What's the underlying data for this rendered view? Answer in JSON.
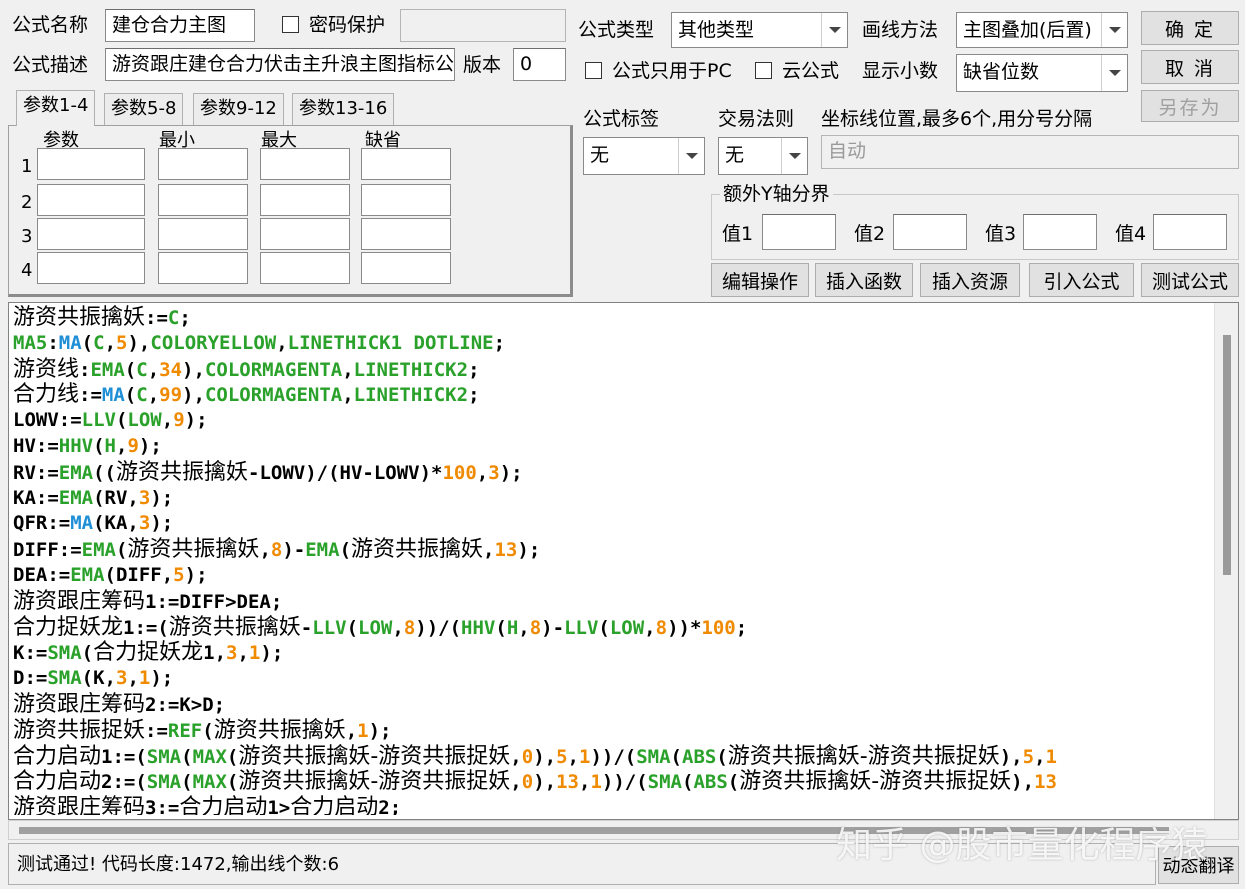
{
  "form": {
    "name_label": "公式名称",
    "name_value": "建仓合力主图",
    "password_label": "密码保护",
    "desc_label": "公式描述",
    "desc_value": "游资跟庄建仓合力伏击主升浪主图指标公",
    "version_label": "版本",
    "version_value": "0",
    "type_label": "公式类型",
    "type_value": "其他类型",
    "draw_label": "画线方法",
    "draw_value": "主图叠加(后置)",
    "pc_only_label": "公式只用于PC",
    "cloud_label": "云公式",
    "decimal_label": "显示小数",
    "decimal_value": "缺省位数",
    "tag_label": "公式标签",
    "tag_value": "无",
    "rule_label": "交易法则",
    "rule_value": "无",
    "coord_label": "坐标线位置,最多6个,用分号分隔",
    "coord_placeholder": "自动",
    "yaxis_group": "额外Y轴分界",
    "yaxis_labels": [
      "值1",
      "值2",
      "值3",
      "值4"
    ]
  },
  "buttons": {
    "ok": "确 定",
    "cancel": "取 消",
    "save_as": "另存为",
    "edit_ops": "编辑操作",
    "insert_func": "插入函数",
    "insert_res": "插入资源",
    "import": "引入公式",
    "test": "测试公式",
    "dyn_translate": "动态翻译"
  },
  "tabs": [
    "参数1-4",
    "参数5-8",
    "参数9-12",
    "参数13-16"
  ],
  "params": {
    "headers": [
      "参数",
      "最小",
      "最大",
      "缺省"
    ],
    "rows": [
      "1",
      "2",
      "3",
      "4"
    ]
  },
  "code_lines": [
    [
      [
        "cjk",
        "游资共振擒妖"
      ],
      [
        "d",
        ":="
      ],
      [
        "f",
        "C"
      ],
      [
        "d",
        ";"
      ]
    ],
    [
      [
        "f",
        "MA5"
      ],
      [
        "d",
        ":"
      ],
      [
        "m",
        "MA"
      ],
      [
        "d",
        "("
      ],
      [
        "f",
        "C"
      ],
      [
        "d",
        ","
      ],
      [
        "n",
        "5"
      ],
      [
        "d",
        "),"
      ],
      [
        "f",
        "COLORYELLOW"
      ],
      [
        "d",
        ","
      ],
      [
        "f",
        "LINETHICK1 DOTLINE"
      ],
      [
        "d",
        ";"
      ]
    ],
    [
      [
        "cjk",
        "游资线"
      ],
      [
        "d",
        ":"
      ],
      [
        "f",
        "EMA"
      ],
      [
        "d",
        "("
      ],
      [
        "f",
        "C"
      ],
      [
        "d",
        ","
      ],
      [
        "n",
        "34"
      ],
      [
        "d",
        "),"
      ],
      [
        "f",
        "COLORMAGENTA"
      ],
      [
        "d",
        ","
      ],
      [
        "f",
        "LINETHICK2"
      ],
      [
        "d",
        ";"
      ]
    ],
    [
      [
        "cjk",
        "合力线"
      ],
      [
        "d",
        ":="
      ],
      [
        "m",
        "MA"
      ],
      [
        "d",
        "("
      ],
      [
        "f",
        "C"
      ],
      [
        "d",
        ","
      ],
      [
        "n",
        "99"
      ],
      [
        "d",
        "),"
      ],
      [
        "f",
        "COLORMAGENTA"
      ],
      [
        "d",
        ","
      ],
      [
        "f",
        "LINETHICK2"
      ],
      [
        "d",
        ";"
      ]
    ],
    [
      [
        "d",
        "LOWV:="
      ],
      [
        "f",
        "LLV"
      ],
      [
        "d",
        "("
      ],
      [
        "f",
        "LOW"
      ],
      [
        "d",
        ","
      ],
      [
        "n",
        "9"
      ],
      [
        "d",
        ");"
      ]
    ],
    [
      [
        "d",
        "HV:="
      ],
      [
        "f",
        "HHV"
      ],
      [
        "d",
        "("
      ],
      [
        "f",
        "H"
      ],
      [
        "d",
        ","
      ],
      [
        "n",
        "9"
      ],
      [
        "d",
        ");"
      ]
    ],
    [
      [
        "d",
        "RV:="
      ],
      [
        "f",
        "EMA"
      ],
      [
        "d",
        "(("
      ],
      [
        "cjk",
        "游资共振擒妖"
      ],
      [
        "d",
        "-LOWV)/(HV-LOWV)*"
      ],
      [
        "n",
        "100"
      ],
      [
        "d",
        ","
      ],
      [
        "n",
        "3"
      ],
      [
        "d",
        ");"
      ]
    ],
    [
      [
        "d",
        "KA:="
      ],
      [
        "f",
        "EMA"
      ],
      [
        "d",
        "(RV,"
      ],
      [
        "n",
        "3"
      ],
      [
        "d",
        ");"
      ]
    ],
    [
      [
        "d",
        "QFR:="
      ],
      [
        "m",
        "MA"
      ],
      [
        "d",
        "(KA,"
      ],
      [
        "n",
        "3"
      ],
      [
        "d",
        ");"
      ]
    ],
    [
      [
        "d",
        "DIFF:="
      ],
      [
        "f",
        "EMA"
      ],
      [
        "d",
        "("
      ],
      [
        "cjk",
        "游资共振擒妖"
      ],
      [
        "d",
        ","
      ],
      [
        "n",
        "8"
      ],
      [
        "d",
        ")-"
      ],
      [
        "f",
        "EMA"
      ],
      [
        "d",
        "("
      ],
      [
        "cjk",
        "游资共振擒妖"
      ],
      [
        "d",
        ","
      ],
      [
        "n",
        "13"
      ],
      [
        "d",
        ");"
      ]
    ],
    [
      [
        "d",
        "DEA:="
      ],
      [
        "f",
        "EMA"
      ],
      [
        "d",
        "(DIFF,"
      ],
      [
        "n",
        "5"
      ],
      [
        "d",
        ");"
      ]
    ],
    [
      [
        "cjk",
        "游资跟庄筹码"
      ],
      [
        "d",
        "1:=DIFF>DEA;"
      ]
    ],
    [
      [
        "cjk",
        "合力捉妖龙"
      ],
      [
        "d",
        "1:=("
      ],
      [
        "cjk",
        "游资共振擒妖"
      ],
      [
        "d",
        "-"
      ],
      [
        "f",
        "LLV"
      ],
      [
        "d",
        "("
      ],
      [
        "f",
        "LOW"
      ],
      [
        "d",
        ","
      ],
      [
        "n",
        "8"
      ],
      [
        "d",
        "))/("
      ],
      [
        "f",
        "HHV"
      ],
      [
        "d",
        "("
      ],
      [
        "f",
        "H"
      ],
      [
        "d",
        ","
      ],
      [
        "n",
        "8"
      ],
      [
        "d",
        ")-"
      ],
      [
        "f",
        "LLV"
      ],
      [
        "d",
        "("
      ],
      [
        "f",
        "LOW"
      ],
      [
        "d",
        ","
      ],
      [
        "n",
        "8"
      ],
      [
        "d",
        "))*"
      ],
      [
        "n",
        "100"
      ],
      [
        "d",
        ";"
      ]
    ],
    [
      [
        "d",
        "K:="
      ],
      [
        "f",
        "SMA"
      ],
      [
        "d",
        "("
      ],
      [
        "cjk",
        "合力捉妖龙"
      ],
      [
        "d",
        "1,"
      ],
      [
        "n",
        "3"
      ],
      [
        "d",
        ","
      ],
      [
        "n",
        "1"
      ],
      [
        "d",
        ");"
      ]
    ],
    [
      [
        "d",
        "D:="
      ],
      [
        "f",
        "SMA"
      ],
      [
        "d",
        "(K,"
      ],
      [
        "n",
        "3"
      ],
      [
        "d",
        ","
      ],
      [
        "n",
        "1"
      ],
      [
        "d",
        ");"
      ]
    ],
    [
      [
        "cjk",
        "游资跟庄筹码"
      ],
      [
        "d",
        "2:=K>D;"
      ]
    ],
    [
      [
        "cjk",
        "游资共振捉妖"
      ],
      [
        "d",
        ":="
      ],
      [
        "f",
        "REF"
      ],
      [
        "d",
        "("
      ],
      [
        "cjk",
        "游资共振擒妖"
      ],
      [
        "d",
        ","
      ],
      [
        "n",
        "1"
      ],
      [
        "d",
        ");"
      ]
    ],
    [
      [
        "cjk",
        "合力启动"
      ],
      [
        "d",
        "1:=("
      ],
      [
        "f",
        "SMA"
      ],
      [
        "d",
        "("
      ],
      [
        "f",
        "MAX"
      ],
      [
        "d",
        "("
      ],
      [
        "cjk",
        "游资共振擒妖-游资共振捉妖"
      ],
      [
        "d",
        ","
      ],
      [
        "n",
        "0"
      ],
      [
        "d",
        "),"
      ],
      [
        "n",
        "5"
      ],
      [
        "d",
        ","
      ],
      [
        "n",
        "1"
      ],
      [
        "d",
        "))/("
      ],
      [
        "f",
        "SMA"
      ],
      [
        "d",
        "("
      ],
      [
        "f",
        "ABS"
      ],
      [
        "d",
        "("
      ],
      [
        "cjk",
        "游资共振擒妖-游资共振捉妖"
      ],
      [
        "d",
        "),"
      ],
      [
        "n",
        "5"
      ],
      [
        "d",
        ","
      ],
      [
        "n",
        "1"
      ]
    ],
    [
      [
        "cjk",
        "合力启动"
      ],
      [
        "d",
        "2:=("
      ],
      [
        "f",
        "SMA"
      ],
      [
        "d",
        "("
      ],
      [
        "f",
        "MAX"
      ],
      [
        "d",
        "("
      ],
      [
        "cjk",
        "游资共振擒妖-游资共振捉妖"
      ],
      [
        "d",
        ","
      ],
      [
        "n",
        "0"
      ],
      [
        "d",
        "),"
      ],
      [
        "n",
        "13"
      ],
      [
        "d",
        ","
      ],
      [
        "n",
        "1"
      ],
      [
        "d",
        "))/("
      ],
      [
        "f",
        "SMA"
      ],
      [
        "d",
        "("
      ],
      [
        "f",
        "ABS"
      ],
      [
        "d",
        "("
      ],
      [
        "cjk",
        "游资共振擒妖-游资共振捉妖"
      ],
      [
        "d",
        "),"
      ],
      [
        "n",
        "13"
      ]
    ],
    [
      [
        "cjk",
        "游资跟庄筹码"
      ],
      [
        "d",
        "3:="
      ],
      [
        "cjk",
        "合力启动"
      ],
      [
        "d",
        "1>"
      ],
      [
        "cjk",
        "合力启动"
      ],
      [
        "d",
        "2;"
      ]
    ]
  ],
  "status_text": "测试通过! 代码长度:1472,输出线个数:6",
  "watermark": "知乎 @股市量化程序猿",
  "colors": {
    "func": "#2aa12a",
    "ma": "#1f8fd6",
    "num": "#f08a00",
    "text": "#000000"
  }
}
